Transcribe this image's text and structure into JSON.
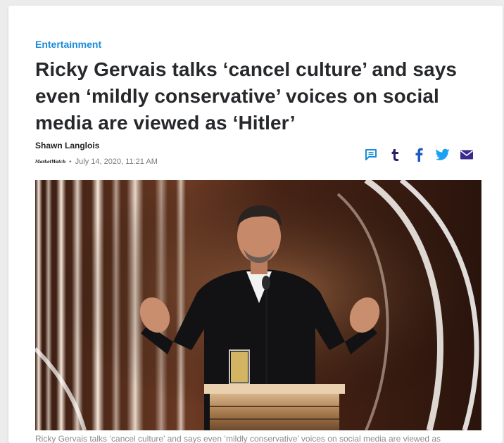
{
  "article": {
    "category": "Entertainment",
    "headline": "Ricky Gervais talks ‘cancel culture’ and says even ‘mildly conservative’ voices on social media are viewed as ‘Hitler’",
    "author": "Shawn Langlois",
    "source_logo": "MarketWatch",
    "separator": "•",
    "date": "July 14, 2020, 11:21 AM",
    "caption": "Ricky Gervais talks ‘cancel culture’ and says even ‘mildly conservative’ voices on social media are viewed as"
  },
  "share": {
    "icons": [
      {
        "name": "comment-icon",
        "color": "#1a8cd8"
      },
      {
        "name": "tumblr-icon",
        "color": "#2a1f6e"
      },
      {
        "name": "facebook-icon",
        "color": "#1a5ac8"
      },
      {
        "name": "twitter-icon",
        "color": "#1da1f2"
      },
      {
        "name": "mail-icon",
        "color": "#3a2a8c"
      }
    ]
  },
  "colors": {
    "accent": "#1a8cd8",
    "headline": "#26282b",
    "meta": "#7a7a7a",
    "page_bg": "#ececec"
  }
}
